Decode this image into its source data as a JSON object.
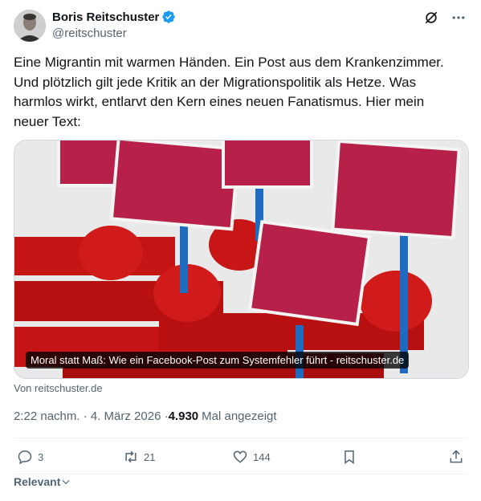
{
  "author": {
    "name": "Boris Reitschuster",
    "handle": "@reitschuster",
    "verified_icon": "verified-badge-icon"
  },
  "top_icons": [
    "grok-icon",
    "more-icon"
  ],
  "text": "Eine Migrantin mit warmen Händen. Ein Post aus dem Krankenzimmer.\nUnd plötzlich gilt jede Kritik an der Migrationspolitik als Hetze. Was\nharmlos wirkt, entlarvt den Kern eines neuen Fanatismus. Hier mein\nneuer Text:",
  "card": {
    "caption": "Moral statt Maß: Wie ein Facebook-Post zum Systemfehler führt - reitschuster.de"
  },
  "source": "Von reitschuster.de",
  "meta": {
    "time_date": "2:22 nachm. · 4. März 2026 · ",
    "views": "4.930",
    "views_label": "Mal angezeigt"
  },
  "actions": {
    "replies": "3",
    "reposts": "21",
    "likes": "144"
  },
  "sort": {
    "label": "Relevant"
  },
  "colors": {
    "text": "#0f1419",
    "secondary": "#536471",
    "verified": "#1d9bf0",
    "divider": "#eff3f4"
  }
}
